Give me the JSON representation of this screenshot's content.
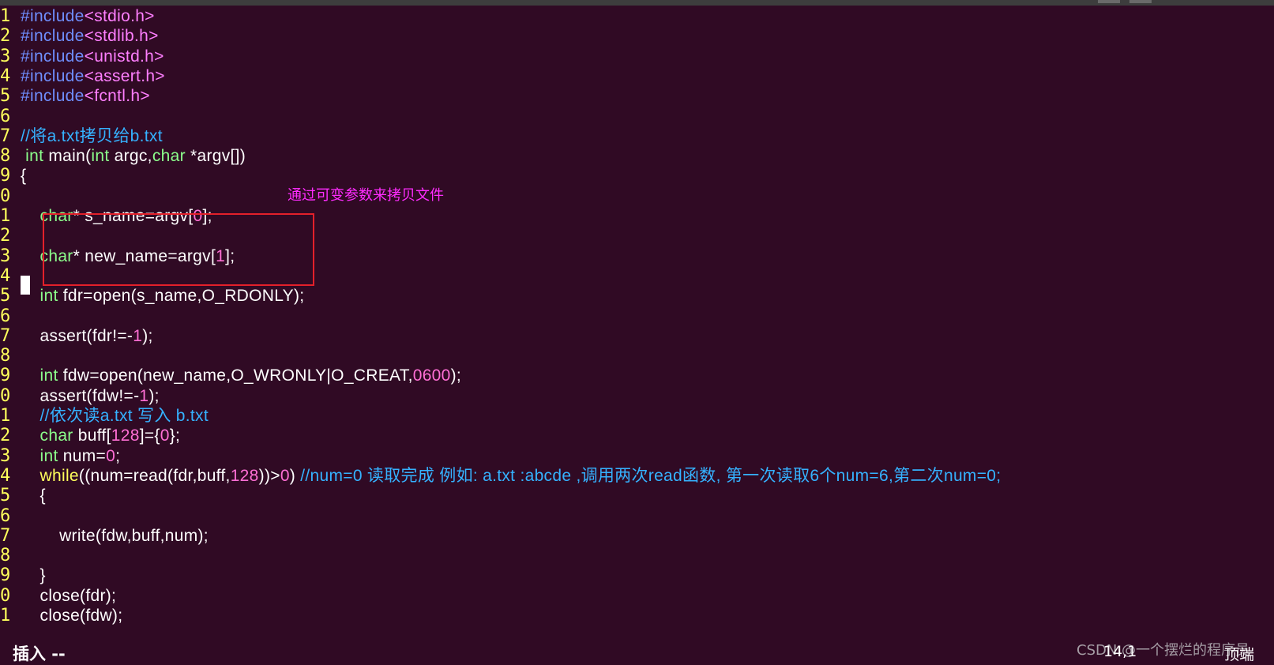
{
  "colors": {
    "background": "#300a24",
    "line_numbers": "#ffff5c",
    "comment": "#35b2ff",
    "annotation": "#ff2cff",
    "highlight_box": "#e3202a"
  },
  "editor": {
    "lines": [
      {
        "n": "1",
        "tokens": [
          {
            "c": "pre",
            "t": "#include"
          },
          {
            "c": "str",
            "t": "<stdio.h>"
          }
        ]
      },
      {
        "n": "2",
        "tokens": [
          {
            "c": "pre",
            "t": "#include"
          },
          {
            "c": "str",
            "t": "<stdlib.h>"
          }
        ]
      },
      {
        "n": "3",
        "tokens": [
          {
            "c": "pre",
            "t": "#include"
          },
          {
            "c": "str",
            "t": "<unistd.h>"
          }
        ]
      },
      {
        "n": "4",
        "tokens": [
          {
            "c": "pre",
            "t": "#include"
          },
          {
            "c": "str",
            "t": "<assert.h>"
          }
        ]
      },
      {
        "n": "5",
        "tokens": [
          {
            "c": "pre",
            "t": "#include"
          },
          {
            "c": "str",
            "t": "<fcntl.h>"
          }
        ]
      },
      {
        "n": "6",
        "tokens": []
      },
      {
        "n": "7",
        "tokens": [
          {
            "c": "com",
            "t": "//将a.txt拷贝给b.txt"
          }
        ]
      },
      {
        "n": "8",
        "tokens": [
          {
            "c": "pl",
            "t": " "
          },
          {
            "c": "type",
            "t": "int"
          },
          {
            "c": "pl",
            "t": " main("
          },
          {
            "c": "type",
            "t": "int"
          },
          {
            "c": "pl",
            "t": " argc,"
          },
          {
            "c": "type",
            "t": "char"
          },
          {
            "c": "pl",
            "t": " *argv[])"
          }
        ]
      },
      {
        "n": "9",
        "tokens": [
          {
            "c": "pl",
            "t": "{"
          }
        ]
      },
      {
        "n": "0",
        "tokens": []
      },
      {
        "n": "1",
        "tokens": [
          {
            "c": "pl",
            "t": "    "
          },
          {
            "c": "type",
            "t": "char"
          },
          {
            "c": "pl",
            "t": "* s_name=argv["
          },
          {
            "c": "num",
            "t": "0"
          },
          {
            "c": "pl",
            "t": "];"
          }
        ]
      },
      {
        "n": "2",
        "tokens": []
      },
      {
        "n": "3",
        "tokens": [
          {
            "c": "pl",
            "t": "    "
          },
          {
            "c": "type",
            "t": "char"
          },
          {
            "c": "pl",
            "t": "* new_name=argv["
          },
          {
            "c": "num",
            "t": "1"
          },
          {
            "c": "pl",
            "t": "];"
          }
        ]
      },
      {
        "n": "4",
        "tokens": []
      },
      {
        "n": "5",
        "tokens": [
          {
            "c": "pl",
            "t": "    "
          },
          {
            "c": "type",
            "t": "int"
          },
          {
            "c": "pl",
            "t": " fdr=open(s_name,O_RDONLY);"
          }
        ]
      },
      {
        "n": "6",
        "tokens": []
      },
      {
        "n": "7",
        "tokens": [
          {
            "c": "pl",
            "t": "    assert(fdr!=-"
          },
          {
            "c": "num",
            "t": "1"
          },
          {
            "c": "pl",
            "t": ");"
          }
        ]
      },
      {
        "n": "8",
        "tokens": []
      },
      {
        "n": "9",
        "tokens": [
          {
            "c": "pl",
            "t": "    "
          },
          {
            "c": "type",
            "t": "int"
          },
          {
            "c": "pl",
            "t": " fdw=open(new_name,O_WRONLY|O_CREAT,"
          },
          {
            "c": "num",
            "t": "0600"
          },
          {
            "c": "pl",
            "t": ");"
          }
        ]
      },
      {
        "n": "0",
        "tokens": [
          {
            "c": "pl",
            "t": "    assert(fdw!=-"
          },
          {
            "c": "num",
            "t": "1"
          },
          {
            "c": "pl",
            "t": ");"
          }
        ]
      },
      {
        "n": "1",
        "tokens": [
          {
            "c": "pl",
            "t": "    "
          },
          {
            "c": "com",
            "t": "//依次读a.txt 写入 b.txt"
          }
        ]
      },
      {
        "n": "2",
        "tokens": [
          {
            "c": "pl",
            "t": "    "
          },
          {
            "c": "type",
            "t": "char"
          },
          {
            "c": "pl",
            "t": " buff["
          },
          {
            "c": "num",
            "t": "128"
          },
          {
            "c": "pl",
            "t": "]={"
          },
          {
            "c": "num",
            "t": "0"
          },
          {
            "c": "pl",
            "t": "};"
          }
        ]
      },
      {
        "n": "3",
        "tokens": [
          {
            "c": "pl",
            "t": "    "
          },
          {
            "c": "type",
            "t": "int"
          },
          {
            "c": "pl",
            "t": " num="
          },
          {
            "c": "num",
            "t": "0"
          },
          {
            "c": "pl",
            "t": ";"
          }
        ]
      },
      {
        "n": "4",
        "tokens": [
          {
            "c": "pl",
            "t": "    "
          },
          {
            "c": "kw",
            "t": "while"
          },
          {
            "c": "pl",
            "t": "((num=read(fdr,buff,"
          },
          {
            "c": "num",
            "t": "128"
          },
          {
            "c": "pl",
            "t": "))>"
          },
          {
            "c": "num",
            "t": "0"
          },
          {
            "c": "pl",
            "t": ") "
          },
          {
            "c": "com",
            "t": "//num=0 读取完成 例如: a.txt :abcde ,调用两次read函数, 第一次读取6个num=6,第二次num=0;"
          }
        ]
      },
      {
        "n": "5",
        "tokens": [
          {
            "c": "pl",
            "t": "    {"
          }
        ]
      },
      {
        "n": "6",
        "tokens": []
      },
      {
        "n": "7",
        "tokens": [
          {
            "c": "pl",
            "t": "        write(fdw,buff,num);"
          }
        ]
      },
      {
        "n": "8",
        "tokens": []
      },
      {
        "n": "9",
        "tokens": [
          {
            "c": "pl",
            "t": "    }"
          }
        ]
      },
      {
        "n": "0",
        "tokens": [
          {
            "c": "pl",
            "t": "    close(fdr);"
          }
        ]
      },
      {
        "n": "1",
        "tokens": [
          {
            "c": "pl",
            "t": "    close(fdw);"
          }
        ]
      }
    ]
  },
  "annotation": {
    "text": "通过可变参数来拷贝文件"
  },
  "status": {
    "mode": "插入 --",
    "position": "14,1",
    "scroll": "顶端"
  },
  "watermark": {
    "text": "CSDN @一个摆烂的程序员"
  }
}
